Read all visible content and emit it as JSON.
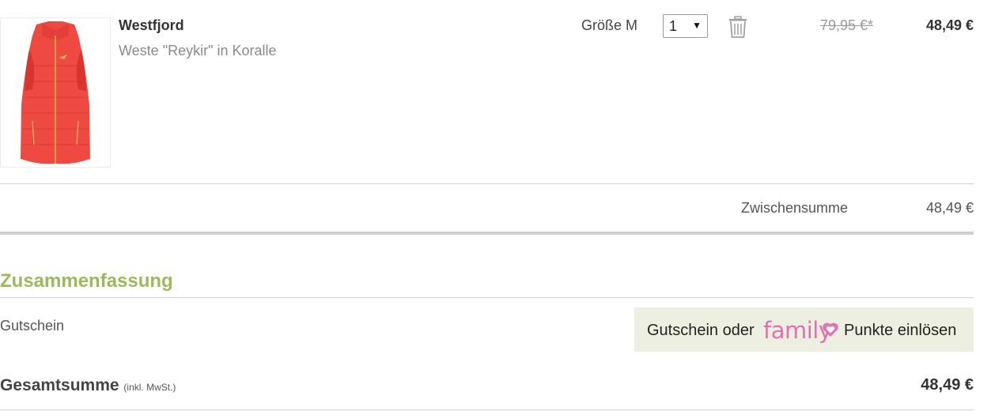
{
  "product": {
    "brand": "Westfjord",
    "name": "Weste \"Reykir\" in Koralle",
    "size_label": "Größe M",
    "quantity": "1",
    "old_price": "79,95 €*",
    "price": "48,49 €",
    "image_icon": "coral-vest-image",
    "remove_icon": "trash-icon"
  },
  "subtotal": {
    "label": "Zwischensumme",
    "value": "48,49 €"
  },
  "summary": {
    "title": "Zusammenfassung",
    "voucher_label": "Gutschein",
    "voucher_button": {
      "prefix": "Gutschein oder",
      "logo_text": "family",
      "logo_icon": "heart-icon",
      "suffix": "Punkte einlösen"
    },
    "total_label": "Gesamtsumme",
    "total_note": "(inkl. MwSt.)",
    "total_value": "48,49 €"
  },
  "colors": {
    "accent_green": "#9cba5a",
    "family_pink": "#e270b3",
    "voucher_bg": "#edf0e1",
    "vest": "#ee4a42"
  }
}
